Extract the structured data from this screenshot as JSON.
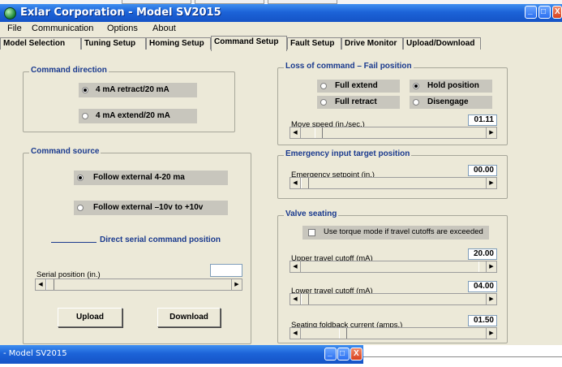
{
  "window": {
    "title": "Exlar Corporation - Model SV2015",
    "minimize_glyph": "_",
    "maximize_glyph": "□",
    "close_glyph": "X"
  },
  "menu": [
    "File",
    "Communication",
    "Options",
    "About"
  ],
  "tabs": [
    {
      "label": "Model Selection",
      "active": false
    },
    {
      "label": "Tuning Setup",
      "active": false
    },
    {
      "label": "Homing Setup",
      "active": false
    },
    {
      "label": "Command Setup",
      "active": true
    },
    {
      "label": "Fault Setup",
      "active": false
    },
    {
      "label": "Drive Monitor",
      "active": false
    },
    {
      "label": "Upload/Download",
      "active": false
    }
  ],
  "command_direction": {
    "title": "Command direction",
    "options": [
      {
        "label": "4 mA retract/20 mA",
        "selected": true
      },
      {
        "label": "4 mA extend/20 mA",
        "selected": false
      }
    ]
  },
  "command_source": {
    "title": "Command source",
    "options": [
      {
        "label": "Follow external 4-20 ma",
        "selected": true
      },
      {
        "label": "Follow external –10v to +10v",
        "selected": false
      }
    ],
    "serial_heading": "Direct serial command position",
    "serial_label": "Serial position (in.)",
    "serial_value": "",
    "upload_label": "Upload",
    "download_label": "Download"
  },
  "loss_of_command": {
    "title": "Loss of command – Fail position",
    "options": [
      {
        "label": "Full extend",
        "selected": false
      },
      {
        "label": "Hold position",
        "selected": true
      },
      {
        "label": "Full retract",
        "selected": false
      },
      {
        "label": "Disengage",
        "selected": false
      }
    ],
    "move_speed_label": "Move speed (in./sec.)",
    "move_speed_value": "01.11"
  },
  "emergency": {
    "title": "Emergency input target position",
    "setpoint_label": "Emergency setpoint (in.)",
    "setpoint_value": "00.00"
  },
  "valve_seating": {
    "title": "Valve seating",
    "torque_checkbox_label": "Use torque mode if travel cutoffs are exceeded",
    "torque_checked": false,
    "upper_label": "Upper travel cutoff (mA)",
    "upper_value": "20.00",
    "lower_label": "Lower travel cutoff (mA)",
    "lower_value": "04.00",
    "foldback_label": "Seating foldback current (amps.)",
    "foldback_value": "01.50"
  },
  "taskbar": {
    "title": "- Model SV2015"
  },
  "colors": {
    "titlebar": "#1c63d8",
    "panel": "#ece9d8",
    "group_title": "#1a3a8e",
    "radio_box": "#c8c6bd"
  }
}
